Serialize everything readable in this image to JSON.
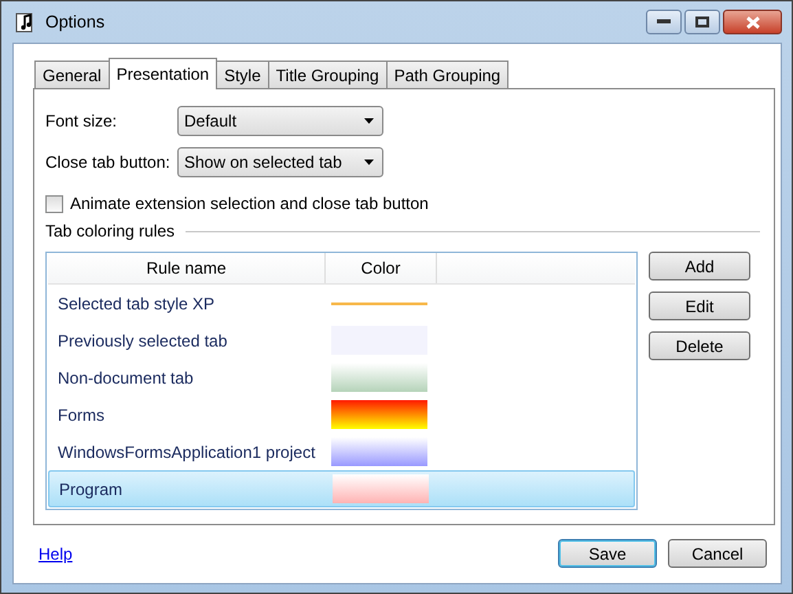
{
  "window": {
    "title": "Options"
  },
  "tabs": [
    {
      "label": "General",
      "selected": false
    },
    {
      "label": "Presentation",
      "selected": true
    },
    {
      "label": "Style",
      "selected": false
    },
    {
      "label": "Title Grouping",
      "selected": false
    },
    {
      "label": "Path Grouping",
      "selected": false
    }
  ],
  "fields": [
    {
      "label": "Font size:",
      "value": "Default"
    },
    {
      "label": "Close tab button:",
      "value": "Show on selected tab"
    }
  ],
  "animate_checkbox": {
    "label": "Animate extension selection and close tab button",
    "checked": false
  },
  "group_title": "Tab coloring rules",
  "table": {
    "columns": [
      "Rule name",
      "Color"
    ],
    "rows": [
      {
        "name": "Selected tab style XP",
        "kind": "line",
        "color": "#f7b84a",
        "selected": false
      },
      {
        "name": "Previously selected tab",
        "kind": "solid",
        "color": "#f3f3fd",
        "selected": false
      },
      {
        "name": "Non-document tab",
        "kind": "fade",
        "color": "#b5d3b9",
        "selected": false
      },
      {
        "name": "Forms",
        "kind": "flame",
        "color": "#ff1a00",
        "selected": false
      },
      {
        "name": "WindowsFormsApplication1 project",
        "kind": "fade",
        "color": "#9999ff",
        "selected": false
      },
      {
        "name": "Program",
        "kind": "fade",
        "color": "#ffb3b3",
        "selected": true
      }
    ]
  },
  "side_buttons": [
    "Add",
    "Edit",
    "Delete"
  ],
  "help_link": "Help",
  "buttons": [
    "Save",
    "Cancel"
  ]
}
